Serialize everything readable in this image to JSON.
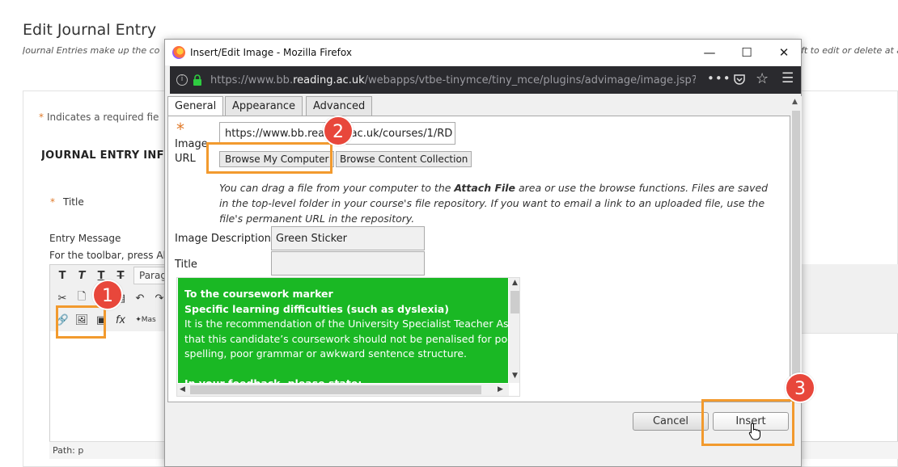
{
  "background_page": {
    "title": "Edit Journal Entry",
    "subtitle_left": "Journal Entries make up the co",
    "subtitle_right": "ft to edit or delete at a",
    "required_note": "Indicates a required fie",
    "section_heading": "JOURNAL ENTRY INFO",
    "title_field_label": "Title",
    "entry_message_label": "Entry Message",
    "toolbar_hint": "For the toolbar, press Al",
    "paragraph_dropdown": "Parag",
    "mashups_label": "Mas",
    "path_bar": "Path: p",
    "required_star": "*"
  },
  "window": {
    "title": "Insert/Edit Image - Mozilla Firefox",
    "url_prefix": "https://www.bb.",
    "url_domain": "reading.ac.uk",
    "url_suffix": "/webapps/vtbe-tinymce/tiny_mce/plugins/advimage/image.jsp?name=",
    "more_icon": "•••"
  },
  "tabs": [
    {
      "label": "General",
      "active": true
    },
    {
      "label": "Appearance",
      "active": false
    },
    {
      "label": "Advanced",
      "active": false
    }
  ],
  "form": {
    "required_star": "*",
    "image_url_label": "Image URL",
    "image_url_value": "https://www.bb.reading.ac.uk/courses/1/RD",
    "browse_computer_label": "Browse My Computer",
    "browse_collection_label": "Browse Content Collection",
    "help_text_before": "You can drag a file from your computer to the ",
    "help_text_bold": "Attach File",
    "help_text_after": " area or use the browse functions. Files are saved in the top-level folder in your course's file repository. If you want to email a link to an uploaded file, use the file's permanent URL in the repository.",
    "image_description_label": "Image Description",
    "image_description_value": "Green Sticker",
    "title_label": "Title",
    "title_value": ""
  },
  "preview": {
    "background_color": "#1ab824",
    "lines": [
      {
        "text": "To the coursework marker",
        "bold": true
      },
      {
        "text": "Specific learning difficulties (such as dyslexia)",
        "bold": true
      },
      {
        "text": "It is the recommendation of the University Specialist Teacher Ass",
        "bold": false
      },
      {
        "text": "that this candidate’s coursework should not be penalised for poo",
        "bold": false
      },
      {
        "text": "spelling, poor grammar or awkward sentence structure.",
        "bold": false
      },
      {
        "text": "",
        "bold": false
      },
      {
        "text": "In your feedback, please state:",
        "bold": true
      }
    ]
  },
  "buttons": {
    "cancel": "Cancel",
    "insert": "Insert"
  },
  "callouts": {
    "step1": "1",
    "step2": "2",
    "step3": "3",
    "color": "#e8473b",
    "highlight_color": "#f29a2e"
  }
}
